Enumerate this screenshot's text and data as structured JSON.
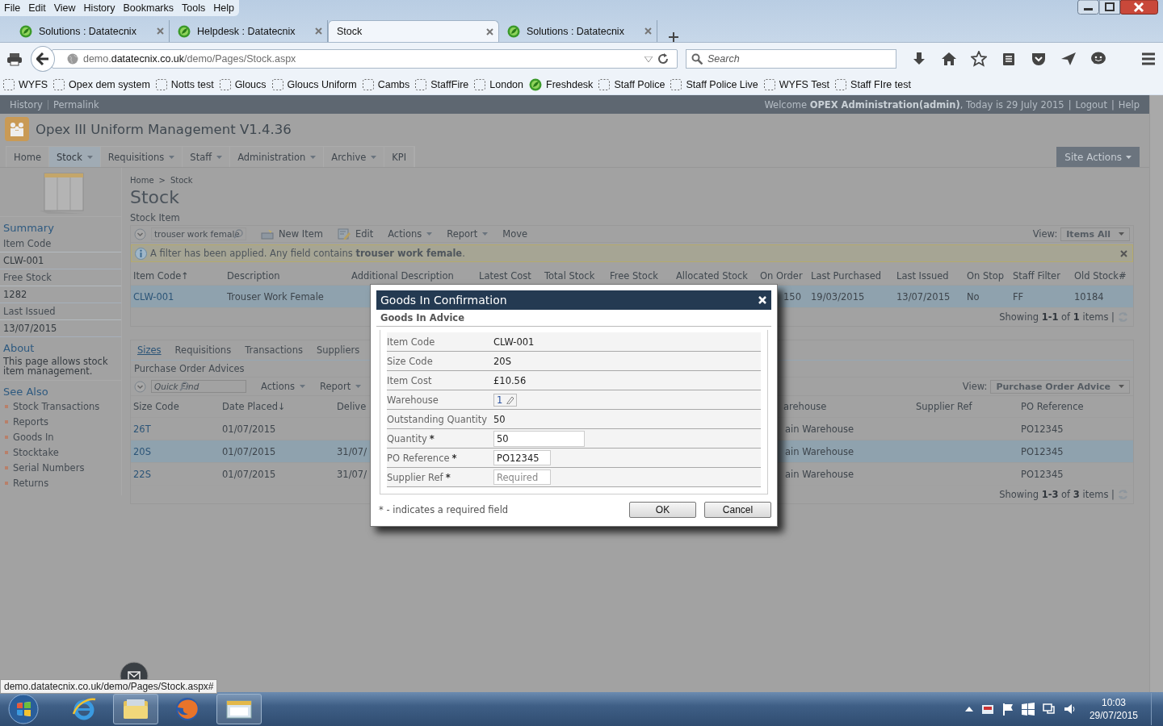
{
  "menu_bar": [
    "File",
    "Edit",
    "View",
    "History",
    "Bookmarks",
    "Tools",
    "Help"
  ],
  "tabs": [
    {
      "label": "Solutions : Datatecnix",
      "kind": "site",
      "selected": false
    },
    {
      "label": "Helpdesk : Datatecnix",
      "kind": "site",
      "selected": false
    },
    {
      "label": "Stock",
      "kind": "plain",
      "selected": true
    },
    {
      "label": "Solutions : Datatecnix",
      "kind": "site",
      "selected": false
    }
  ],
  "address_bar": {
    "url": "demo.**datatecnix.co.uk**/demo/Pages/Stock.aspx"
  },
  "search": {
    "placeholder": "Search"
  },
  "bookmarks": [
    {
      "label": "WYFS",
      "kind": "folder"
    },
    {
      "label": "Opex dem system",
      "kind": "folder"
    },
    {
      "label": "Notts test",
      "kind": "folder"
    },
    {
      "label": "Gloucs",
      "kind": "folder"
    },
    {
      "label": "Gloucs Uniform",
      "kind": "folder"
    },
    {
      "label": "Cambs",
      "kind": "folder"
    },
    {
      "label": "StaffFire",
      "kind": "folder"
    },
    {
      "label": "London",
      "kind": "folder"
    },
    {
      "label": "Freshdesk",
      "kind": "site"
    },
    {
      "label": "Staff Police",
      "kind": "folder"
    },
    {
      "label": "Staff Police Live",
      "kind": "folder"
    },
    {
      "label": "WYFS Test",
      "kind": "folder"
    },
    {
      "label": "Staff FIre test",
      "kind": "folder"
    }
  ],
  "app": {
    "top_links": [
      "History",
      "Permalink"
    ],
    "welcome": "Welcome **OPEX Administration(admin)**, Today is 29 July 2015",
    "link_separator": "|",
    "account_links": [
      "Logout",
      "Help"
    ],
    "title": "Opex III Uniform Management V1.4.36",
    "nav": [
      {
        "label": "Home",
        "dropdown": false,
        "selected": false
      },
      {
        "label": "Stock",
        "dropdown": true,
        "selected": true
      },
      {
        "label": "Requisitions",
        "dropdown": true,
        "selected": false
      },
      {
        "label": "Staff",
        "dropdown": true,
        "selected": false
      },
      {
        "label": "Administration",
        "dropdown": true,
        "selected": false
      },
      {
        "label": "Archive",
        "dropdown": true,
        "selected": false
      },
      {
        "label": "KPI",
        "dropdown": false,
        "selected": false
      }
    ],
    "site_actions": "Site Actions"
  },
  "breadcrumb": [
    "Home",
    "Stock"
  ],
  "breadcrumb_separator": ">",
  "page_title": "Stock",
  "sidebar": {
    "summary_heading": "Summary",
    "summary": [
      {
        "label": "Item Code",
        "value": "CLW-001"
      },
      {
        "label": "Free Stock",
        "value": "1282"
      },
      {
        "label": "Last Issued",
        "value": "13/07/2015"
      }
    ],
    "about_heading": "About",
    "about_text": "This page allows stock item management.",
    "see_also_heading": "See Also",
    "links": [
      "Stock Transactions",
      "Reports",
      "Goods In",
      "Stocktake",
      "Serial Numbers",
      "Returns"
    ]
  },
  "stock_grid": {
    "caption": "Stock Item",
    "search_value": "trouser work female",
    "toolbar": [
      {
        "label": "New Item",
        "kind": "new"
      },
      {
        "label": "Edit",
        "kind": "edit"
      },
      {
        "label": "Actions",
        "kind": "menu"
      },
      {
        "label": "Report",
        "kind": "menu"
      },
      {
        "label": "Move",
        "kind": "plain"
      }
    ],
    "view_label": "View:",
    "view_value": "Items All",
    "filter_message": "A filter has been applied. Any field contains **trouser work female**.",
    "columns": [
      "Item Code↑",
      "Description",
      "Additional Description",
      "Latest Cost",
      "Total Stock",
      "Free Stock",
      "Allocated Stock",
      "On Order",
      "Last Purchased",
      "Last Issued",
      "On Stop",
      "Staff Filter",
      "Old Stock#"
    ],
    "rows": [
      {
        "item_code": "CLW-001",
        "description": "Trouser Work Female",
        "on_order": "150",
        "last_purchased": "19/03/2015",
        "last_issued": "13/07/2015",
        "on_stop": "No",
        "staff_filter": "FF",
        "old_stock": "10184",
        "selected": true
      }
    ],
    "footer": "Showing **1-1** of **1** items |"
  },
  "po_grid": {
    "tabs": [
      {
        "label": "Sizes",
        "selected": true
      },
      {
        "label": "Requisitions",
        "selected": false
      },
      {
        "label": "Transactions",
        "selected": false
      },
      {
        "label": "Suppliers",
        "selected": false
      }
    ],
    "caption": "Purchase Order Advices",
    "quick_find_placeholder": "Quick Find",
    "toolbar": [
      {
        "label": "Actions",
        "kind": "menu"
      },
      {
        "label": "Report",
        "kind": "menu"
      }
    ],
    "view_label": "View:",
    "view_value": "Purchase Order Advice",
    "columns": [
      "Size Code",
      "Date Placed↓",
      "Delive",
      "arehouse",
      "Supplier Ref",
      "PO Reference"
    ],
    "rows": [
      {
        "size_code": "26T",
        "date_placed": "01/07/2015",
        "warehouse": "ain Warehouse",
        "po_reference": "PO12345",
        "selected": false
      },
      {
        "size_code": "20S",
        "date_placed": "01/07/2015",
        "delivery": "31/07/",
        "warehouse": "ain Warehouse",
        "po_reference": "PO12345",
        "selected": true
      },
      {
        "size_code": "22S",
        "date_placed": "01/07/2015",
        "delivery": "31/07/",
        "warehouse": "ain Warehouse",
        "po_reference": "PO12345",
        "selected": false
      }
    ],
    "footer": "Showing **1-3** of **3** items |"
  },
  "dialog": {
    "title": "Goods In Confirmation",
    "section": "Goods In Advice",
    "fields": [
      {
        "label": "Item Code",
        "kind": "text",
        "value": "CLW-001"
      },
      {
        "label": "Size Code",
        "kind": "text",
        "value": "20S"
      },
      {
        "label": "Item Cost",
        "kind": "text",
        "value": "£10.56"
      },
      {
        "label": "Warehouse",
        "kind": "lookup",
        "value": "1"
      },
      {
        "label": "Outstanding Quantity",
        "kind": "text",
        "value": "50"
      },
      {
        "label": "Quantity",
        "kind": "input",
        "value": "50",
        "marker": "*"
      },
      {
        "label": "PO Reference",
        "kind": "short_input",
        "value": "PO12345",
        "marker": "*"
      },
      {
        "label": "Supplier Ref",
        "kind": "short_input",
        "placeholder": "Required",
        "marker": "*"
      }
    ],
    "note": "* - indicates a required field",
    "buttons": [
      "OK",
      "Cancel"
    ]
  },
  "status_url": "demo.datatecnix.co.uk/demo/Pages/Stock.aspx#",
  "taskbar": {
    "time": "10:03",
    "date": "29/07/2015"
  }
}
